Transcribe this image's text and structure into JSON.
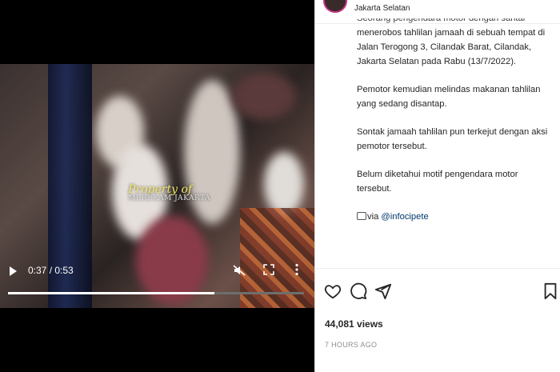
{
  "post": {
    "location": "Jakarta Selatan",
    "caption": {
      "cut_line": "Seorang pengendara motor dengan santai",
      "p1": [
        "menerobos tahlilan jamaah di sebuah tempat di",
        "Jalan Terogong 3, Cilandak Barat, Cilandak,",
        "Jakarta Selatan pada Rabu (13/7/2022)."
      ],
      "p2": [
        "Pemotor kemudian melindas makanan tahlilan",
        "yang sedang disantap."
      ],
      "p3": [
        "Sontak jamaah tahlilan pun terkejut dengan aksi",
        "pemotor tersebut."
      ],
      "p4": [
        "Belum diketahui motif pengendara motor",
        "tersebut."
      ],
      "via_prefix": "via ",
      "via_handle": "@infocipete"
    },
    "views": "44,081 views",
    "time_ago": "7 HOURS AGO"
  },
  "video": {
    "current_time": "0:37",
    "duration": "0:53",
    "time_display": "0:37 / 0:53",
    "progress_fraction": 0.698,
    "watermark_line1": "Property of",
    "watermark_line2": "MEREKAM JAKARTA"
  },
  "icons": {
    "play": "play-icon",
    "mute": "mute-icon",
    "fullscreen": "fullscreen-icon",
    "more": "more-vertical-icon",
    "like": "heart-icon",
    "comment": "comment-icon",
    "share": "paper-plane-icon",
    "save": "bookmark-icon"
  }
}
